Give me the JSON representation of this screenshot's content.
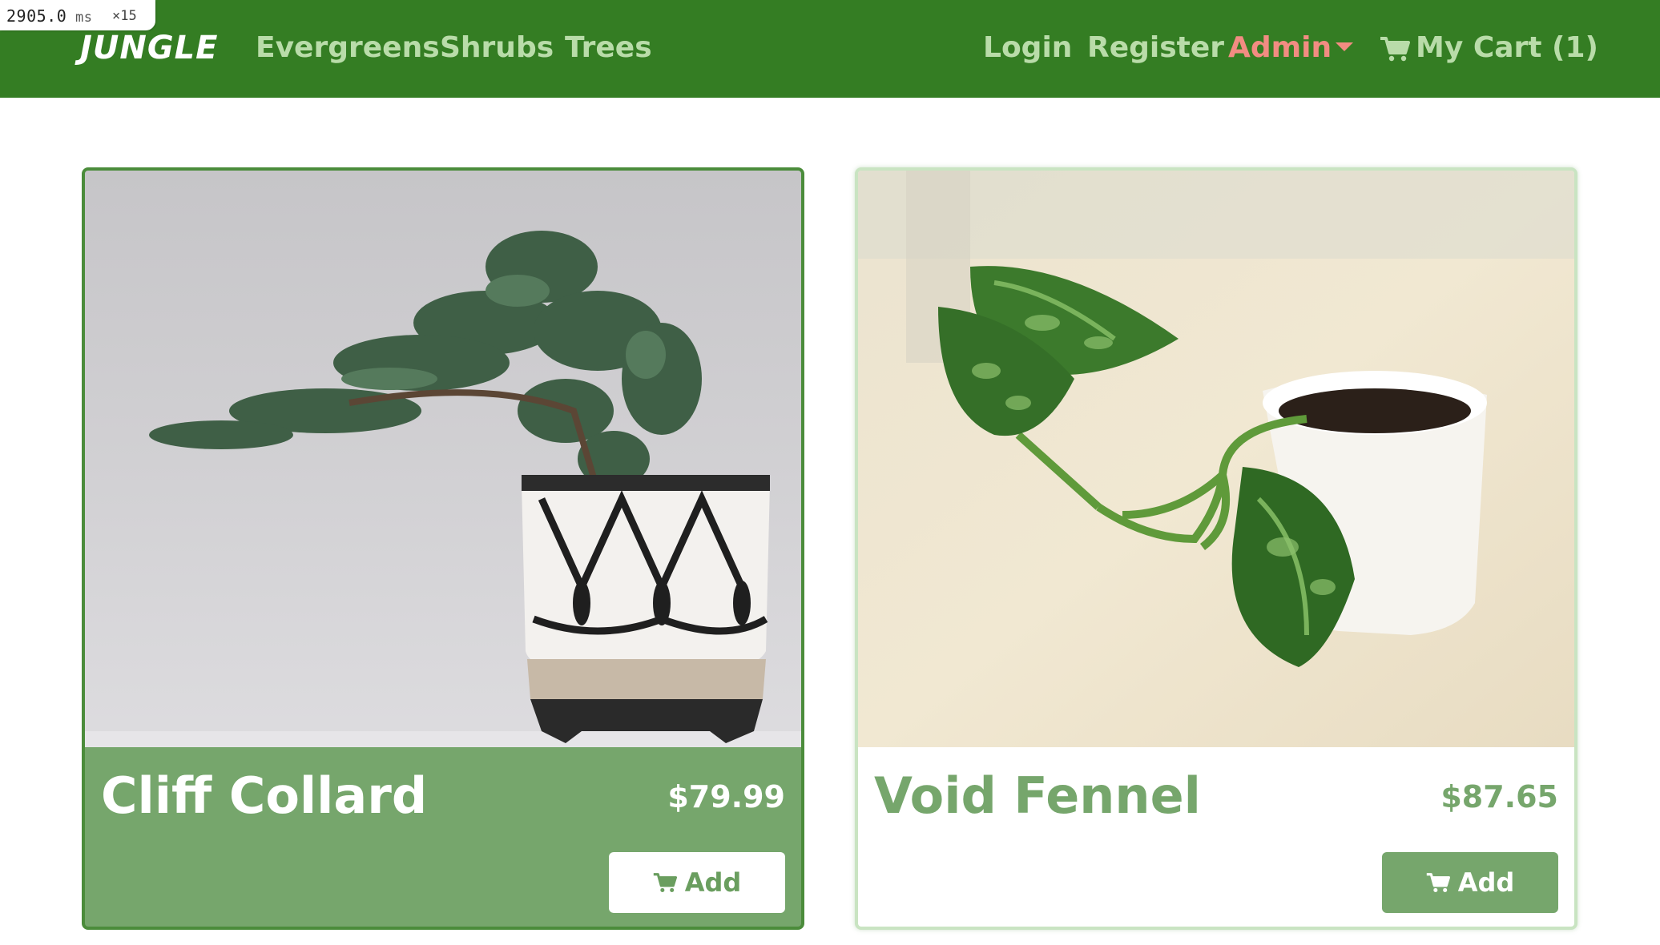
{
  "debug": {
    "timing": "2905.0",
    "unit": "ms",
    "multiplier": "×15"
  },
  "navbar": {
    "brand": "JUNGLE",
    "links": [
      "Evergreens",
      "Shrubs",
      "Trees"
    ],
    "login": "Login",
    "register": "Register",
    "admin": "Admin",
    "cart": "My Cart (1)",
    "colors": {
      "background": "#347d23",
      "link": "#b9dca9",
      "admin": "#f28c82"
    },
    "icons": {
      "admin_dropdown": "chevron-down-icon",
      "cart": "cart-icon"
    }
  },
  "products": [
    {
      "name": "Cliff Collard",
      "price": "$79.99",
      "button": "Add",
      "image": "potted juniper bonsai in patterned pot",
      "button_icon": "cart-icon"
    },
    {
      "name": "Void Fennel",
      "price": "$87.65",
      "button": "Add",
      "image": "pothos cutting in small white pot",
      "button_icon": "cart-icon"
    }
  ],
  "colors": {
    "accent": "#76a66c",
    "card_selected_border": "#4b8c3b",
    "card_border": "#c9e4c2"
  }
}
